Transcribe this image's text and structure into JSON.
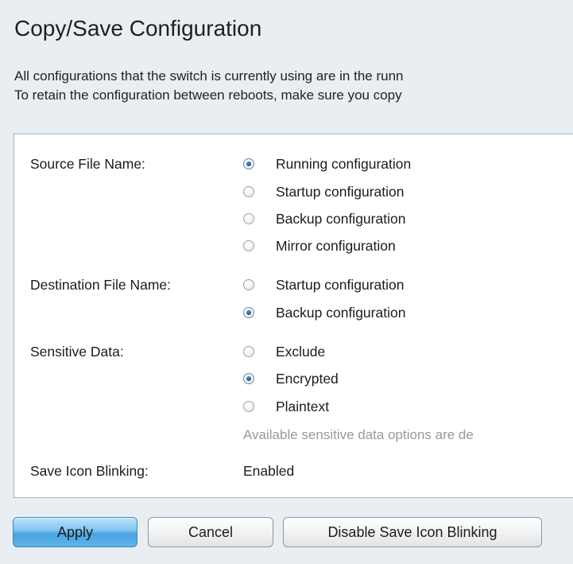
{
  "page": {
    "title": "Copy/Save Configuration",
    "description_line1": "All configurations that the switch is currently using are in the runn",
    "description_line2": "To retain the configuration between reboots, make sure you copy"
  },
  "form": {
    "source": {
      "label": "Source File Name:",
      "options": [
        {
          "label": "Running configuration",
          "checked": true
        },
        {
          "label": "Startup configuration",
          "checked": false
        },
        {
          "label": "Backup configuration",
          "checked": false
        },
        {
          "label": "Mirror configuration",
          "checked": false
        }
      ]
    },
    "destination": {
      "label": "Destination File Name:",
      "options": [
        {
          "label": "Startup configuration",
          "checked": false
        },
        {
          "label": "Backup configuration",
          "checked": true
        }
      ]
    },
    "sensitive": {
      "label": "Sensitive Data:",
      "options": [
        {
          "label": "Exclude",
          "checked": false
        },
        {
          "label": "Encrypted",
          "checked": true
        },
        {
          "label": "Plaintext",
          "checked": false
        }
      ],
      "note": "Available sensitive data options are de"
    },
    "save_icon": {
      "label": "Save Icon Blinking:",
      "value": "Enabled"
    }
  },
  "buttons": {
    "apply": "Apply",
    "cancel": "Cancel",
    "disable_blinking": "Disable Save Icon Blinking"
  },
  "colors": {
    "page_background": "#e9eef3",
    "panel_background": "#ffffff",
    "primary_button": "#4aa3e1",
    "radio_selected": "#1c4f8e"
  }
}
